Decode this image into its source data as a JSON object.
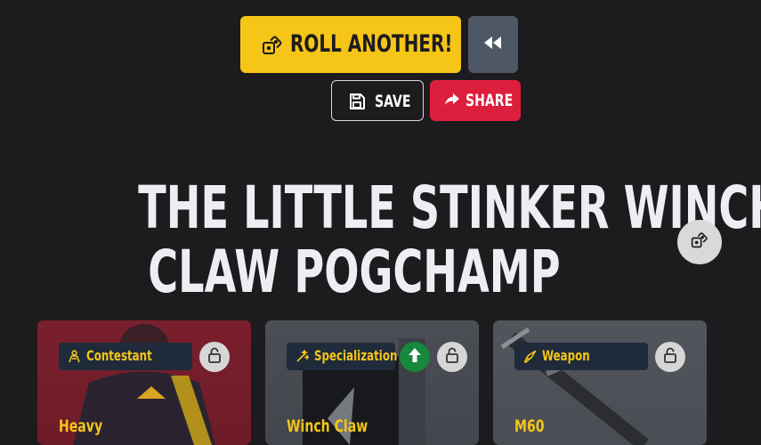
{
  "actions": {
    "roll_label": "ROLL ANOTHER!",
    "save_label": "SAVE",
    "share_label": "SHARE"
  },
  "build": {
    "title_lines": [
      "THE LITTLE STINKER WINCH",
      "CLAW POGCHAMP"
    ]
  },
  "cards": [
    {
      "tag": "Contestant",
      "name": "Heavy",
      "icon": "contestant-icon",
      "locked": false,
      "boosted": false
    },
    {
      "tag": "Specialization",
      "name": "Winch Claw",
      "icon": "specialization-icon",
      "locked": false,
      "boosted": true
    },
    {
      "tag": "Weapon",
      "name": "M60",
      "icon": "weapon-icon",
      "locked": false,
      "boosted": false
    }
  ],
  "colors": {
    "background": "#1e1b1e",
    "accent_yellow": "#f5c518",
    "share_red": "#dc1f3c",
    "rewind_gray": "#4e5766",
    "tag_navy": "#1f2b3b",
    "boost_green": "#17883c"
  }
}
